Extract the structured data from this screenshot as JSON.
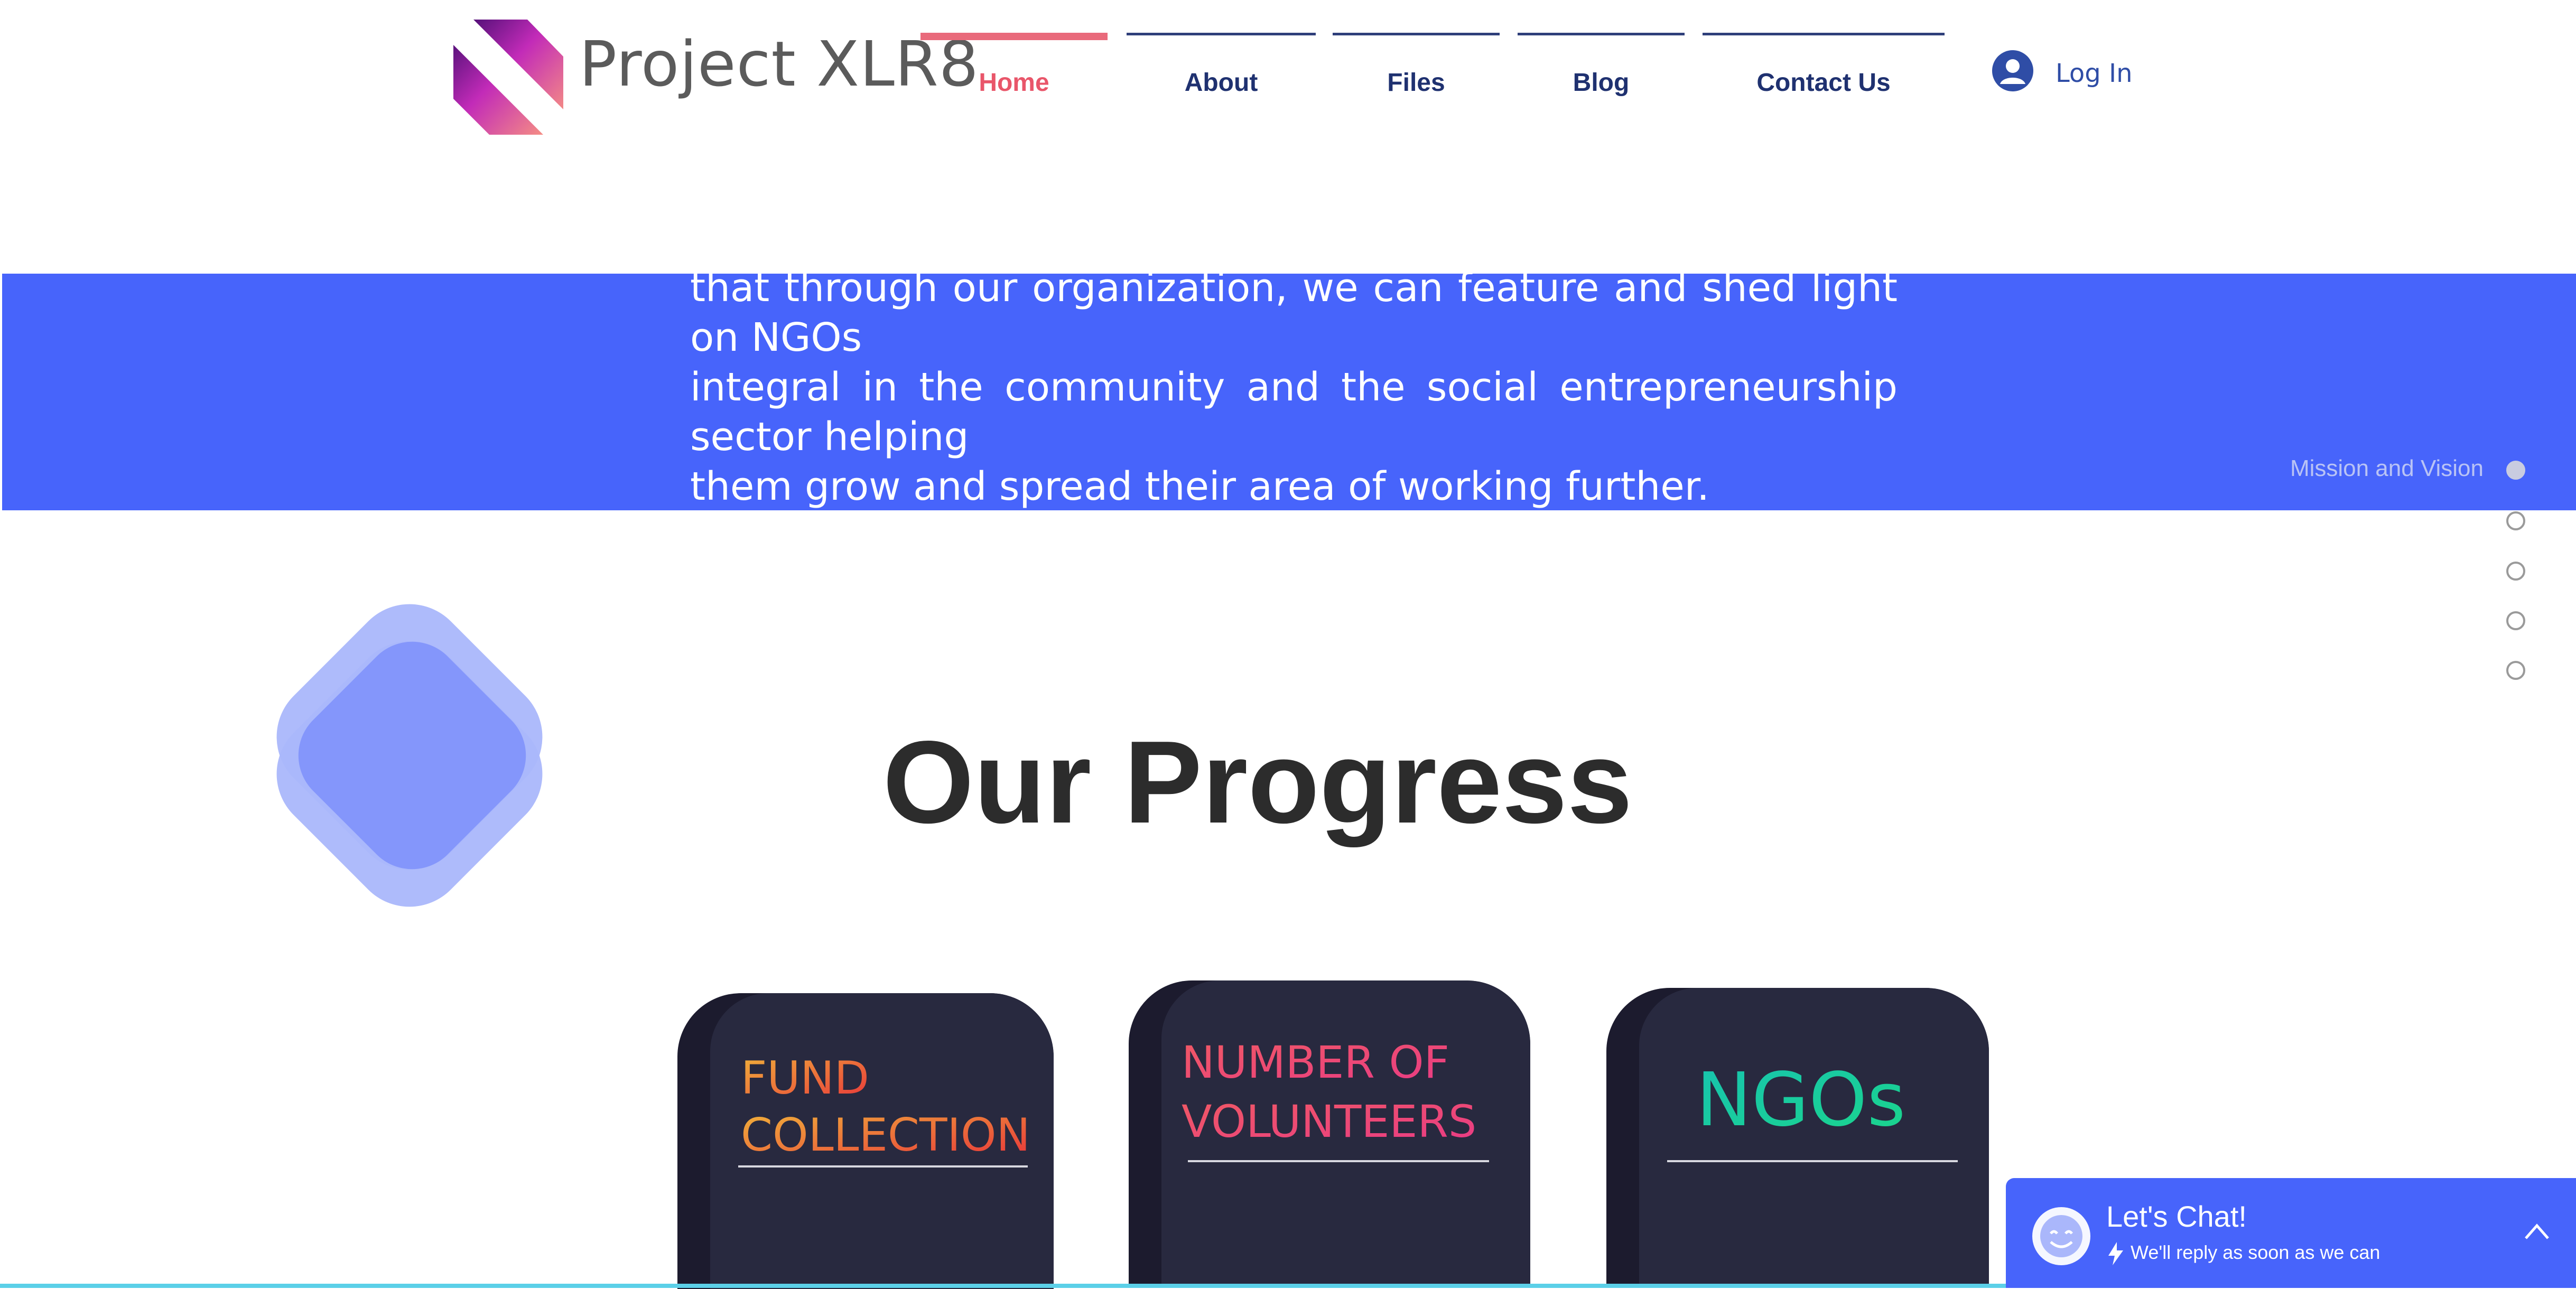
{
  "header": {
    "brand": "Project XLR8",
    "nav": [
      {
        "label": "Home",
        "active": true
      },
      {
        "label": "About",
        "active": false
      },
      {
        "label": "Files",
        "active": false
      },
      {
        "label": "Blog",
        "active": false
      },
      {
        "label": "Contact Us",
        "active": false
      }
    ],
    "login_label": "Log In"
  },
  "mission": {
    "text": "that through our organization, we can feature and shed light on NGOs\nintegral in the community and the social entrepreneurship sector helping\nthem grow and spread their area of working further.",
    "section_label": "Mission and Vision",
    "section_dots": 5,
    "active_dot": 0
  },
  "progress": {
    "title": "Our Progress",
    "cards": [
      {
        "title": "FUND\nCOLLECTION",
        "gradient": [
          "#f0b43a",
          "#e8323a"
        ]
      },
      {
        "title": "NUMBER OF\nVOLUNTEERS",
        "gradient": [
          "#f05a63",
          "#e93a86"
        ]
      },
      {
        "title": "NGOs",
        "gradient": [
          "#18c3b0",
          "#1ad58a"
        ]
      }
    ]
  },
  "chat": {
    "title": "Let's Chat!",
    "subtitle": "We'll reply as soon as we can"
  },
  "colors": {
    "brand_blue": "#4764fb",
    "nav_active": "#e9566a",
    "nav_text": "#1f3170",
    "card_bg": "#28293f"
  }
}
